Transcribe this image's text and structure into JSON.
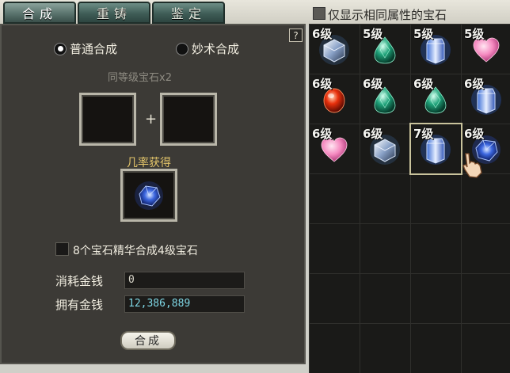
{
  "tabs": [
    {
      "label": "合成",
      "active": true
    },
    {
      "label": "重铸",
      "active": false
    },
    {
      "label": "鉴定",
      "active": false
    }
  ],
  "help": "?",
  "mode": {
    "normal_label": "普通合成",
    "special_label": "妙术合成",
    "selected": "normal"
  },
  "slots_hint": "同等级宝石x2",
  "plus": "+",
  "result_label": "几率获得",
  "essence_option": {
    "label": "8个宝石精华合成4级宝石",
    "checked": false
  },
  "cost": {
    "label": "消耗金钱",
    "value": "0"
  },
  "owned": {
    "label": "拥有金钱",
    "value": "12,386,889"
  },
  "compose_button": "合成",
  "filter": {
    "label": "仅显示相同属性的宝石",
    "checked": false
  },
  "colors": {
    "panel": "#3c3a36",
    "gold": "#e3c56a",
    "money": "#7fd8e6"
  },
  "inventory": [
    {
      "level": "6级",
      "gem": "ice-cube-gem"
    },
    {
      "level": "5级",
      "gem": "green-drop-gem"
    },
    {
      "level": "5级",
      "gem": "blue-crystal-gem"
    },
    {
      "level": "5级",
      "gem": "pink-heart-gem"
    },
    {
      "level": "6级",
      "gem": "red-oval-gem"
    },
    {
      "level": "6级",
      "gem": "green-drop-gem"
    },
    {
      "level": "6级",
      "gem": "green-drop-gem"
    },
    {
      "level": "6级",
      "gem": "blue-crystal-gem"
    },
    {
      "level": "6级",
      "gem": "pink-heart-gem"
    },
    {
      "level": "6级",
      "gem": "ice-cube-gem"
    },
    {
      "level": "7级",
      "gem": "blue-crystal-gem",
      "selected": true
    },
    {
      "level": "6级",
      "gem": "blue-faceted-gem"
    }
  ],
  "inventory_total_cells": 28
}
